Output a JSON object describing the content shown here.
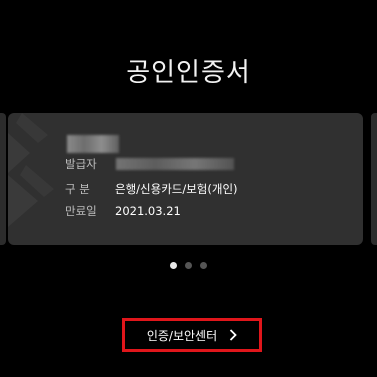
{
  "header": {
    "title": "공인인증서"
  },
  "certificate": {
    "issuer_label": "발급자",
    "type_label": "구  분",
    "type_value": "은행/신용카드/보험(개인)",
    "expiry_label": "만료일",
    "expiry_value": "2021.03.21"
  },
  "pager": {
    "count": 3,
    "active": 0
  },
  "security_button": {
    "label": "인증/보안센터",
    "icon": "chevron-right-icon"
  },
  "colors": {
    "accent": "#e0161b",
    "card": "#303030",
    "background": "#000000"
  }
}
